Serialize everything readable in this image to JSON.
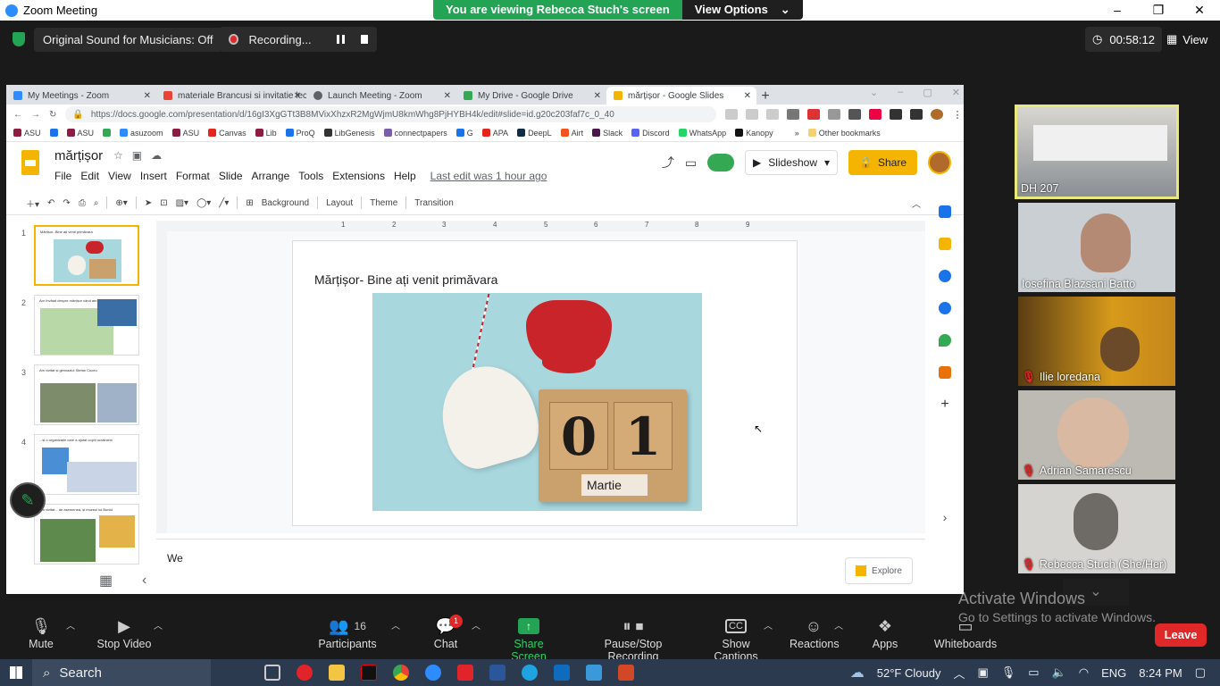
{
  "zoom": {
    "window_title": "Zoom Meeting",
    "window_controls": [
      "–",
      "❐",
      "✕"
    ],
    "viewing_banner": "You are viewing Rebecca Stuch's screen",
    "view_options": "View Options",
    "original_sound": "Original Sound for Musicians: Off",
    "recording": "Recording...",
    "timer": "00:58:12",
    "view_label": "View",
    "accent_green": "#23a455",
    "controls": {
      "mute": "Mute",
      "stop_video": "Stop Video",
      "participants": "Participants",
      "participants_count": "16",
      "chat": "Chat",
      "chat_badge": "1",
      "share_screen": "Share Screen",
      "pause_stop_recording": "Pause/Stop Recording",
      "show_captions": "Show Captions",
      "captions_icon": "CC",
      "reactions": "Reactions",
      "apps": "Apps",
      "whiteboards": "Whiteboards",
      "leave": "Leave"
    },
    "participants": [
      {
        "name": "DH 207",
        "muted": false
      },
      {
        "name": "Iosefina Blazsani Batto",
        "muted": false
      },
      {
        "name": "Ilie loredana",
        "muted": true
      },
      {
        "name": "Adrian Samarescu",
        "muted": true
      },
      {
        "name": "Rebecca Stuch (She/Her)",
        "muted": true
      }
    ],
    "watermark_title": "Activate Windows",
    "watermark_sub": "Go to Settings to activate Windows."
  },
  "browser": {
    "tabs": [
      {
        "label": "My Meetings - Zoom",
        "color": "#2d8cff"
      },
      {
        "label": "materiale Brancusi si invitatie lec",
        "color": "#ea4335"
      },
      {
        "label": "Launch Meeting - Zoom",
        "color": "#5f6368"
      },
      {
        "label": "My Drive - Google Drive",
        "color": "#34a853"
      },
      {
        "label": "mărțișor - Google Slides",
        "color": "#f4b400"
      }
    ],
    "url": "https://docs.google.com/presentation/d/16gI3XgGTt3B8MVixXhzxR2MgWjmU8kmWhg8PjHYBH4k/edit#slide=id.g20c203faf7c_0_40",
    "bookmarks": [
      {
        "label": "ASU",
        "color": "#8c1d40"
      },
      {
        "label": "ASU",
        "color": "#1a73e8"
      },
      {
        "label": "asuzoom",
        "color": "#2d8cff"
      },
      {
        "label": "ASU",
        "color": "#8c1d40"
      },
      {
        "label": "Canvas",
        "color": "#e4251b"
      },
      {
        "label": "Lib",
        "color": "#8c1d40"
      },
      {
        "label": "ProQ",
        "color": "#1a73e8"
      },
      {
        "label": "LibGenesis",
        "color": "#333333"
      },
      {
        "label": "connectpapers",
        "color": "#7b5ea7"
      },
      {
        "label": "G",
        "color": "#1a73e8"
      },
      {
        "label": "APA",
        "color": "#e4251b"
      },
      {
        "label": "DeepL",
        "color": "#0f2b46"
      },
      {
        "label": "Airt",
        "color": "#f4511e"
      },
      {
        "label": "Slack",
        "color": "#4a154b"
      },
      {
        "label": "Discord",
        "color": "#5865f2"
      },
      {
        "label": "WhatsApp",
        "color": "#25d366"
      },
      {
        "label": "Kanopy",
        "color": "#111111"
      }
    ],
    "other_bookmarks": "Other bookmarks"
  },
  "slides": {
    "doc_title": "mărțișor",
    "menu": [
      "File",
      "Edit",
      "View",
      "Insert",
      "Format",
      "Slide",
      "Arrange",
      "Tools",
      "Extensions",
      "Help"
    ],
    "last_edit": "Last edit was 1 hour ago",
    "slideshow": "Slideshow",
    "share": "Share",
    "toolbar": {
      "background": "Background",
      "layout": "Layout",
      "theme": "Theme",
      "transition": "Transition"
    },
    "ruler_ticks": [
      "1",
      "2",
      "3",
      "4",
      "5",
      "6",
      "7",
      "8",
      "9"
    ],
    "slide_title": "Mărțișor- Bine ați venit primăvara",
    "calendar_digits": [
      "0",
      "1"
    ],
    "calendar_month": "Martie",
    "thumbnails": [
      {
        "num": "1",
        "text": "Mărțișor- Bine ați venit primăvara",
        "selected": true
      },
      {
        "num": "2",
        "text": "Am învățat despre mărțișor când am fost în Moldova.",
        "selected": false
      },
      {
        "num": "3",
        "text": "Am vizitat și gimnaziul Ștefan Cuceu",
        "selected": false
      },
      {
        "num": "4",
        "text": "...și o organizație care a ajutat copiii ucrainieni",
        "selected": false
      },
      {
        "num": "5",
        "text": "Am vizitat... de asemenea, și muzeul lui Bunici",
        "selected": false
      }
    ],
    "notes": "We",
    "explore": "Explore"
  },
  "taskbar": {
    "search": "Search",
    "weather": "52°F  Cloudy",
    "language": "ENG",
    "time": "8:24 PM"
  }
}
